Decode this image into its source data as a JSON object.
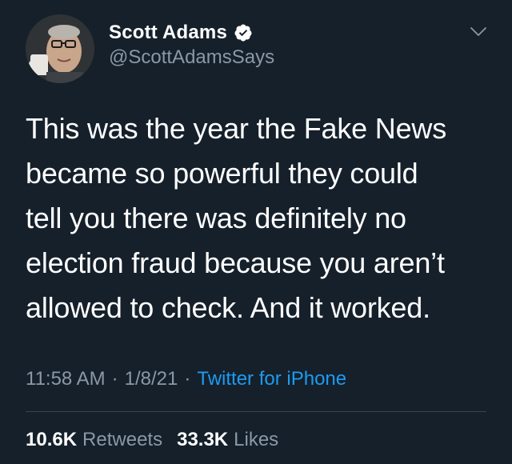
{
  "user": {
    "display_name": "Scott Adams",
    "handle": "@ScottAdamsSays",
    "verified": true,
    "avatar_icon": "profile-photo"
  },
  "tweet": {
    "text": "This was the year the Fake News\nbecame so powerful they could\ntell you there was definitely no\nelection fraud because you aren’t\nallowed to check. And it worked.",
    "time": "11:58 AM",
    "date": "1/8/21",
    "separator": "·",
    "source": "Twitter for iPhone"
  },
  "stats": {
    "retweets_count": "10.6K",
    "retweets_label": "Retweets",
    "likes_count": "33.3K",
    "likes_label": "Likes"
  },
  "icons": {
    "verified": "verified-badge-icon",
    "menu": "chevron-down-icon"
  },
  "colors": {
    "background": "#15202b",
    "primary_text": "#ffffff",
    "secondary_text": "#8b98a5",
    "link": "#1d9bf0",
    "divider": "#38444d"
  }
}
